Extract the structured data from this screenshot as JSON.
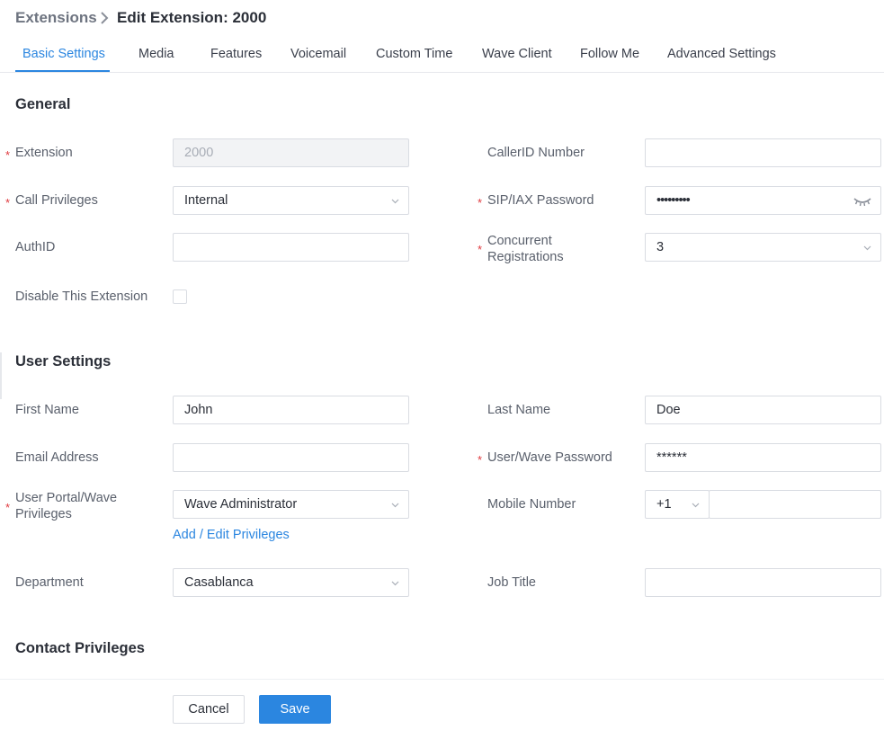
{
  "breadcrumb": {
    "parent": "Extensions",
    "current": "Edit Extension: 2000"
  },
  "tabs": [
    {
      "label": "Basic Settings",
      "active": true
    },
    {
      "label": "Media"
    },
    {
      "label": "Features"
    },
    {
      "label": "Voicemail"
    },
    {
      "label": "Custom Time"
    },
    {
      "label": "Wave Client"
    },
    {
      "label": "Follow Me"
    },
    {
      "label": "Advanced Settings"
    }
  ],
  "general": {
    "title": "General",
    "extension": {
      "label": "Extension",
      "value": "2000"
    },
    "callerid": {
      "label": "CallerID Number",
      "value": ""
    },
    "call_privileges": {
      "label": "Call Privileges",
      "value": "Internal"
    },
    "sip_password": {
      "label": "SIP/IAX Password",
      "value": "•••••••••"
    },
    "authid": {
      "label": "AuthID",
      "value": ""
    },
    "concurrent": {
      "label_line1": "Concurrent",
      "label_line2": "Registrations",
      "value": "3"
    },
    "disable": {
      "label": "Disable This Extension",
      "checked": false
    }
  },
  "user_settings": {
    "title": "User Settings",
    "first_name": {
      "label": "First Name",
      "value": "John"
    },
    "last_name": {
      "label": "Last Name",
      "value": "Doe"
    },
    "email": {
      "label": "Email Address",
      "value": ""
    },
    "user_password": {
      "label": "User/Wave Password",
      "value": "******"
    },
    "portal_privileges": {
      "label_line1": "User Portal/Wave",
      "label_line2": "Privileges",
      "value": "Wave Administrator"
    },
    "add_edit_link": "Add / Edit Privileges",
    "mobile": {
      "label": "Mobile Number",
      "country_code": "+1",
      "value": ""
    },
    "department": {
      "label": "Department",
      "value": "Casablanca"
    },
    "job_title": {
      "label": "Job Title",
      "value": ""
    }
  },
  "contact_privileges": {
    "title": "Contact Privileges"
  },
  "required_mark": "*",
  "footer": {
    "cancel": "Cancel",
    "save": "Save"
  },
  "colors": {
    "accent": "#2b86e0",
    "required": "#e0393e"
  }
}
